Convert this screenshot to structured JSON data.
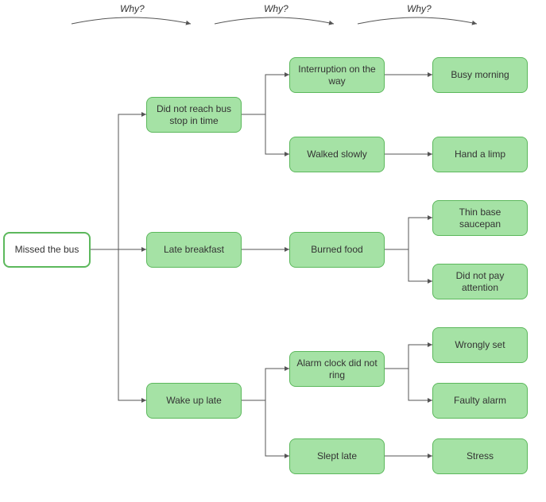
{
  "header": {
    "why1": "Why?",
    "why2": "Why?",
    "why3": "Why?"
  },
  "root": {
    "label": "Missed the bus"
  },
  "level1": [
    {
      "label": "Did not reach bus stop in time"
    },
    {
      "label": "Late breakfast"
    },
    {
      "label": "Wake up late"
    }
  ],
  "level2": [
    {
      "label": "Interruption on the way"
    },
    {
      "label": "Walked slowly"
    },
    {
      "label": "Burned food"
    },
    {
      "label": "Alarm clock did not ring"
    },
    {
      "label": "Slept late"
    }
  ],
  "level3": [
    {
      "label": "Busy morning"
    },
    {
      "label": "Hand a limp"
    },
    {
      "label": "Thin base saucepan"
    },
    {
      "label": "Did not pay attention"
    },
    {
      "label": "Wrongly set"
    },
    {
      "label": "Faulty alarm"
    },
    {
      "label": "Stress"
    }
  ]
}
